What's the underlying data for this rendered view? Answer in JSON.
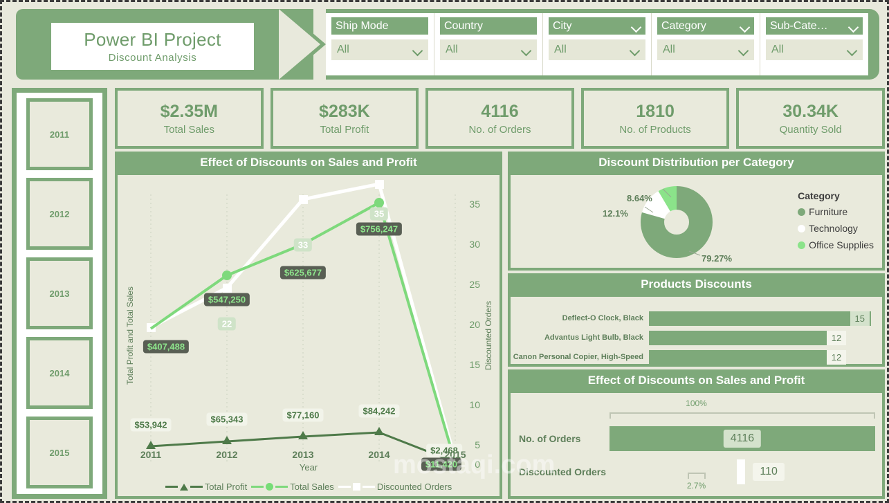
{
  "header": {
    "title": "Power BI Project",
    "subtitle": "Discount  Analysis"
  },
  "filters": [
    {
      "label": "Ship Mode",
      "value": "All",
      "has_label_chevron": false
    },
    {
      "label": "Country",
      "value": "All",
      "has_label_chevron": false
    },
    {
      "label": "City",
      "value": "All",
      "has_label_chevron": false
    },
    {
      "label": "Category",
      "value": "All",
      "has_label_chevron": true
    },
    {
      "label": "Sub-Cate…",
      "value": "All",
      "has_label_chevron": true
    }
  ],
  "year_slicer": {
    "years": [
      "2011",
      "2012",
      "2013",
      "2014",
      "2015"
    ]
  },
  "kpis": [
    {
      "value": "$2.35M",
      "label": "Total Sales"
    },
    {
      "value": "$283K",
      "label": "Total Profit"
    },
    {
      "value": "4116",
      "label": "No. of Orders"
    },
    {
      "value": "1810",
      "label": "No. of Products"
    },
    {
      "value": "30.34K",
      "label": "Quantity Sold"
    }
  ],
  "panels": {
    "line_chart_title": "Effect of Discounts on Sales and Profit",
    "donut_title": "Discount Distribution per Category",
    "products_title": "Products Discounts",
    "funnel_title": "Effect of Discounts on Sales and Profit"
  },
  "chart_data": [
    {
      "type": "line",
      "title": "Effect of Discounts on Sales and Profit",
      "xlabel": "Year",
      "ylabel": "Total Profit and Total Sales",
      "y2label": "Discounted Orders",
      "categories": [
        "2011",
        "2012",
        "2013",
        "2014",
        "2015"
      ],
      "y2lim": [
        0,
        35
      ],
      "y2ticks": [
        "0",
        "5",
        "10",
        "15",
        "20",
        "25",
        "30",
        "35"
      ],
      "grid": true,
      "legend_position": "bottom",
      "series": [
        {
          "name": "Total Profit",
          "axis": "left",
          "color": "#4E7A49",
          "marker": "triangle",
          "values": [
            53942,
            65343,
            77160,
            84242,
            2468
          ],
          "labels": [
            "$53,942",
            "$65,343",
            "$77,160",
            "$84,242",
            "$2,468"
          ]
        },
        {
          "name": "Total Sales",
          "axis": "left",
          "color": "#77DD77",
          "marker": "circle",
          "values": [
            407488,
            547250,
            625677,
            756247,
            11420
          ],
          "labels": [
            "$407,488",
            "$547,250",
            "$625,677",
            "$756,247",
            "$11,420"
          ]
        },
        {
          "name": "Discounted Orders",
          "axis": "right",
          "color": "#FFFFFF",
          "marker": "square",
          "values": [
            19,
            22,
            33,
            35,
            1
          ],
          "labels": [
            "",
            "22",
            "33",
            "35",
            ""
          ]
        }
      ]
    },
    {
      "type": "pie",
      "title": "Discount Distribution per Category",
      "legend_title": "Category",
      "legend_position": "right",
      "labels": [
        "Furniture",
        "Technology",
        "Office Supplies"
      ],
      "values": [
        79.27,
        12.1,
        8.64
      ],
      "value_labels": [
        "79.27%",
        "12.1%",
        "8.64%"
      ],
      "colors": [
        "#7EA97A",
        "#FFFFFF",
        "#8BE38A"
      ]
    },
    {
      "type": "bar",
      "title": "Products Discounts",
      "orientation": "horizontal",
      "categories": [
        "Deflect-O Clock, Black",
        "Advantus Light Bulb, Black",
        "Canon Personal Copier, High-Speed"
      ],
      "values": [
        15,
        12,
        12
      ],
      "value_labels": [
        "15",
        "12",
        "12"
      ],
      "highlighted": 0
    },
    {
      "type": "bar",
      "title": "Effect of Discounts on Sales and Profit",
      "orientation": "funnel",
      "scale_label": "100%",
      "categories": [
        "No. of Orders",
        "Discounted Orders"
      ],
      "values": [
        4116,
        110
      ],
      "value_labels": [
        "4116",
        "110"
      ],
      "percent_labels": [
        "100%",
        "2.7%"
      ]
    }
  ],
  "watermark": "mostaqi.com"
}
